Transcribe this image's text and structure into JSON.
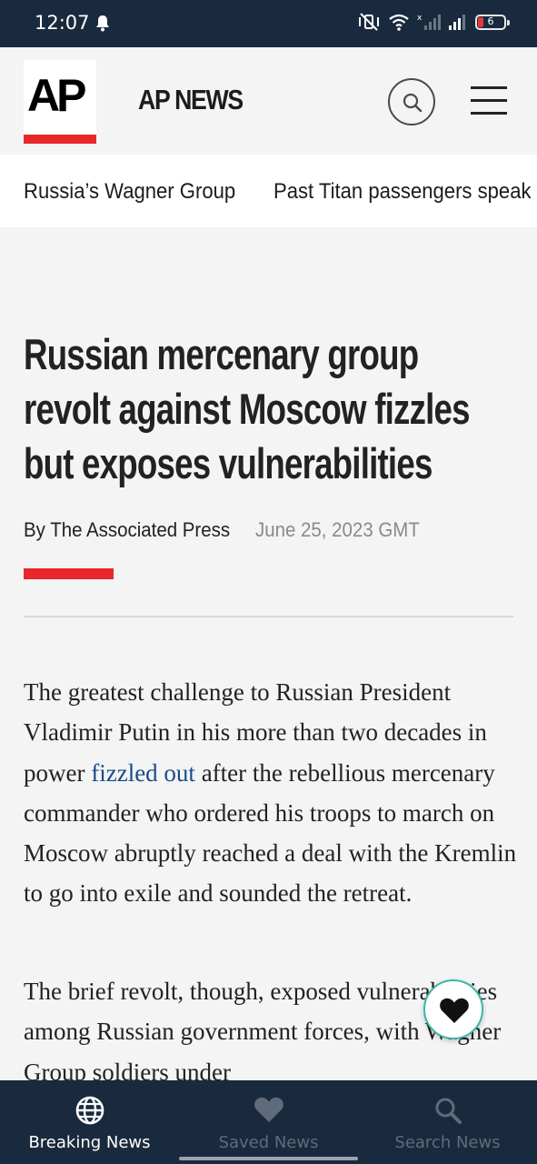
{
  "status_bar": {
    "time": "12:07",
    "battery": "6"
  },
  "header": {
    "logo_text": "AP",
    "title": "AP NEWS"
  },
  "trending": {
    "items": [
      "Russia’s Wagner Group",
      "Past Titan passengers speak"
    ]
  },
  "article": {
    "headline": "Russian mercenary group revolt against Moscow fizzles but exposes vulnerabilities",
    "byline": "By The Associated Press",
    "date": "June 25, 2023 GMT",
    "para1_before": "The greatest challenge to Russian President Vladimir Putin in his more than two decades in power ",
    "para1_link": "fizzled out",
    "para1_after": " after the rebellious mercenary commander who ordered his troops to march on Moscow abruptly reached a deal with the Kremlin to go into exile and sounded the retreat.",
    "para2": "The brief revolt, though, exposed vulnerabilities among Russian government forces, with Wagner Group soldiers under"
  },
  "bottom_nav": {
    "items": [
      {
        "label": "Breaking News",
        "icon": "globe-icon",
        "active": true
      },
      {
        "label": "Saved News",
        "icon": "heart-icon",
        "active": false
      },
      {
        "label": "Search News",
        "icon": "search-icon",
        "active": false
      }
    ]
  },
  "colors": {
    "brand_red": "#e8272a",
    "nav_bg": "#1a2a3e",
    "link": "#1a4a8a",
    "fab_border": "#3bb6a6"
  }
}
